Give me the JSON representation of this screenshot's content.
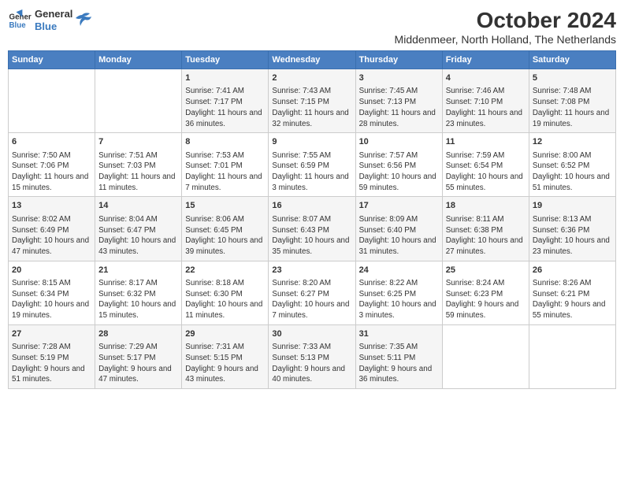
{
  "logo": {
    "line1": "General",
    "line2": "Blue"
  },
  "title": "October 2024",
  "subtitle": "Middenmeer, North Holland, The Netherlands",
  "days_of_week": [
    "Sunday",
    "Monday",
    "Tuesday",
    "Wednesday",
    "Thursday",
    "Friday",
    "Saturday"
  ],
  "weeks": [
    [
      {
        "day": "",
        "info": ""
      },
      {
        "day": "",
        "info": ""
      },
      {
        "day": "1",
        "info": "Sunrise: 7:41 AM\nSunset: 7:17 PM\nDaylight: 11 hours and 36 minutes."
      },
      {
        "day": "2",
        "info": "Sunrise: 7:43 AM\nSunset: 7:15 PM\nDaylight: 11 hours and 32 minutes."
      },
      {
        "day": "3",
        "info": "Sunrise: 7:45 AM\nSunset: 7:13 PM\nDaylight: 11 hours and 28 minutes."
      },
      {
        "day": "4",
        "info": "Sunrise: 7:46 AM\nSunset: 7:10 PM\nDaylight: 11 hours and 23 minutes."
      },
      {
        "day": "5",
        "info": "Sunrise: 7:48 AM\nSunset: 7:08 PM\nDaylight: 11 hours and 19 minutes."
      }
    ],
    [
      {
        "day": "6",
        "info": "Sunrise: 7:50 AM\nSunset: 7:06 PM\nDaylight: 11 hours and 15 minutes."
      },
      {
        "day": "7",
        "info": "Sunrise: 7:51 AM\nSunset: 7:03 PM\nDaylight: 11 hours and 11 minutes."
      },
      {
        "day": "8",
        "info": "Sunrise: 7:53 AM\nSunset: 7:01 PM\nDaylight: 11 hours and 7 minutes."
      },
      {
        "day": "9",
        "info": "Sunrise: 7:55 AM\nSunset: 6:59 PM\nDaylight: 11 hours and 3 minutes."
      },
      {
        "day": "10",
        "info": "Sunrise: 7:57 AM\nSunset: 6:56 PM\nDaylight: 10 hours and 59 minutes."
      },
      {
        "day": "11",
        "info": "Sunrise: 7:59 AM\nSunset: 6:54 PM\nDaylight: 10 hours and 55 minutes."
      },
      {
        "day": "12",
        "info": "Sunrise: 8:00 AM\nSunset: 6:52 PM\nDaylight: 10 hours and 51 minutes."
      }
    ],
    [
      {
        "day": "13",
        "info": "Sunrise: 8:02 AM\nSunset: 6:49 PM\nDaylight: 10 hours and 47 minutes."
      },
      {
        "day": "14",
        "info": "Sunrise: 8:04 AM\nSunset: 6:47 PM\nDaylight: 10 hours and 43 minutes."
      },
      {
        "day": "15",
        "info": "Sunrise: 8:06 AM\nSunset: 6:45 PM\nDaylight: 10 hours and 39 minutes."
      },
      {
        "day": "16",
        "info": "Sunrise: 8:07 AM\nSunset: 6:43 PM\nDaylight: 10 hours and 35 minutes."
      },
      {
        "day": "17",
        "info": "Sunrise: 8:09 AM\nSunset: 6:40 PM\nDaylight: 10 hours and 31 minutes."
      },
      {
        "day": "18",
        "info": "Sunrise: 8:11 AM\nSunset: 6:38 PM\nDaylight: 10 hours and 27 minutes."
      },
      {
        "day": "19",
        "info": "Sunrise: 8:13 AM\nSunset: 6:36 PM\nDaylight: 10 hours and 23 minutes."
      }
    ],
    [
      {
        "day": "20",
        "info": "Sunrise: 8:15 AM\nSunset: 6:34 PM\nDaylight: 10 hours and 19 minutes."
      },
      {
        "day": "21",
        "info": "Sunrise: 8:17 AM\nSunset: 6:32 PM\nDaylight: 10 hours and 15 minutes."
      },
      {
        "day": "22",
        "info": "Sunrise: 8:18 AM\nSunset: 6:30 PM\nDaylight: 10 hours and 11 minutes."
      },
      {
        "day": "23",
        "info": "Sunrise: 8:20 AM\nSunset: 6:27 PM\nDaylight: 10 hours and 7 minutes."
      },
      {
        "day": "24",
        "info": "Sunrise: 8:22 AM\nSunset: 6:25 PM\nDaylight: 10 hours and 3 minutes."
      },
      {
        "day": "25",
        "info": "Sunrise: 8:24 AM\nSunset: 6:23 PM\nDaylight: 9 hours and 59 minutes."
      },
      {
        "day": "26",
        "info": "Sunrise: 8:26 AM\nSunset: 6:21 PM\nDaylight: 9 hours and 55 minutes."
      }
    ],
    [
      {
        "day": "27",
        "info": "Sunrise: 7:28 AM\nSunset: 5:19 PM\nDaylight: 9 hours and 51 minutes."
      },
      {
        "day": "28",
        "info": "Sunrise: 7:29 AM\nSunset: 5:17 PM\nDaylight: 9 hours and 47 minutes."
      },
      {
        "day": "29",
        "info": "Sunrise: 7:31 AM\nSunset: 5:15 PM\nDaylight: 9 hours and 43 minutes."
      },
      {
        "day": "30",
        "info": "Sunrise: 7:33 AM\nSunset: 5:13 PM\nDaylight: 9 hours and 40 minutes."
      },
      {
        "day": "31",
        "info": "Sunrise: 7:35 AM\nSunset: 5:11 PM\nDaylight: 9 hours and 36 minutes."
      },
      {
        "day": "",
        "info": ""
      },
      {
        "day": "",
        "info": ""
      }
    ]
  ]
}
